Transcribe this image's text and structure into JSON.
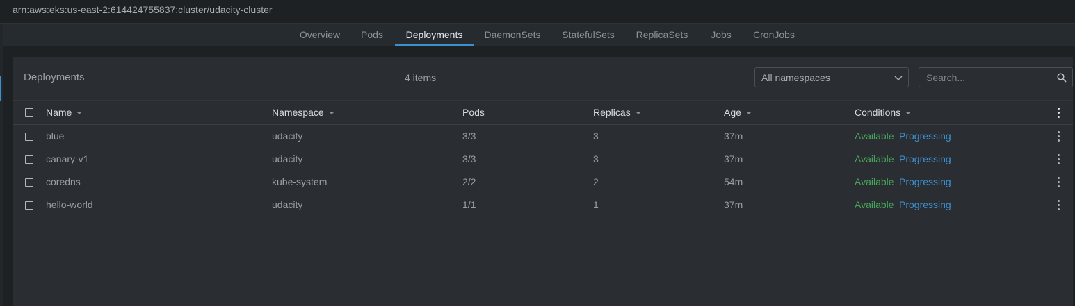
{
  "window": {
    "title": "arn:aws:eks:us-east-2:614424755837:cluster/udacity-cluster"
  },
  "tabs": [
    {
      "label": "Overview",
      "active": false
    },
    {
      "label": "Pods",
      "active": false
    },
    {
      "label": "Deployments",
      "active": true
    },
    {
      "label": "DaemonSets",
      "active": false
    },
    {
      "label": "StatefulSets",
      "active": false
    },
    {
      "label": "ReplicaSets",
      "active": false
    },
    {
      "label": "Jobs",
      "active": false
    },
    {
      "label": "CronJobs",
      "active": false
    }
  ],
  "panel": {
    "title": "Deployments",
    "item_count": "4 items",
    "namespace_select": "All namespaces",
    "search_placeholder": "Search...",
    "search_icon": "search-icon",
    "chevron_icon": "chevron-down-icon"
  },
  "table": {
    "columns": [
      "Name",
      "Namespace",
      "Pods",
      "Replicas",
      "Age",
      "Conditions"
    ],
    "rows": [
      {
        "name": "blue",
        "namespace": "udacity",
        "pods": "3/3",
        "replicas": "3",
        "age": "37m",
        "cond1": "Available",
        "cond2": "Progressing"
      },
      {
        "name": "canary-v1",
        "namespace": "udacity",
        "pods": "3/3",
        "replicas": "3",
        "age": "37m",
        "cond1": "Available",
        "cond2": "Progressing"
      },
      {
        "name": "coredns",
        "namespace": "kube-system",
        "pods": "2/2",
        "replicas": "2",
        "age": "54m",
        "cond1": "Available",
        "cond2": "Progressing"
      },
      {
        "name": "hello-world",
        "namespace": "udacity",
        "pods": "1/1",
        "replicas": "1",
        "age": "37m",
        "cond1": "Available",
        "cond2": "Progressing"
      }
    ]
  },
  "colors": {
    "accent": "#3d90ce",
    "available": "#48a65b",
    "progressing": "#3d90ce",
    "background": "#1e2124",
    "panel": "#2a2e33"
  }
}
